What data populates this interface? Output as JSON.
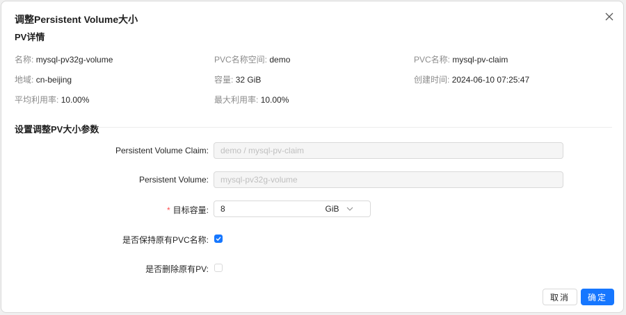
{
  "dialog": {
    "title": "调整Persistent Volume大小"
  },
  "pv_details": {
    "section_title": "PV详情",
    "name": {
      "label": "名称:",
      "value": "mysql-pv32g-volume"
    },
    "pvc_namespace": {
      "label": "PVC名称空间:",
      "value": "demo"
    },
    "pvc_name": {
      "label": "PVC名称:",
      "value": "mysql-pv-claim"
    },
    "region": {
      "label": "地域:",
      "value": "cn-beijing"
    },
    "capacity": {
      "label": "容量:",
      "value": "32 GiB"
    },
    "created_at": {
      "label": "创建时间:",
      "value": "2024-06-10 07:25:47"
    },
    "avg_usage": {
      "label": "平均利用率:",
      "value": "10.00%"
    },
    "max_usage": {
      "label": "最大利用率:",
      "value": "10.00%"
    }
  },
  "resize_params": {
    "section_title": "设置调整PV大小参数",
    "pvc": {
      "label": "Persistent Volume Claim:",
      "placeholder": "demo / mysql-pv-claim"
    },
    "pv": {
      "label": "Persistent Volume:",
      "placeholder": "mysql-pv32g-volume"
    },
    "target_capacity": {
      "required_mark": "*",
      "label": "目标容量:",
      "value": "8",
      "unit": "GiB"
    },
    "keep_pvc_name": {
      "label": "是否保持原有PVC名称:",
      "checked": true
    },
    "delete_original_pv": {
      "label": "是否删除原有PV:",
      "checked": false
    }
  },
  "footer": {
    "cancel_label": "取消",
    "ok_label": "确定"
  },
  "colors": {
    "primary": "#1677ff",
    "required": "#ff4d4f"
  }
}
